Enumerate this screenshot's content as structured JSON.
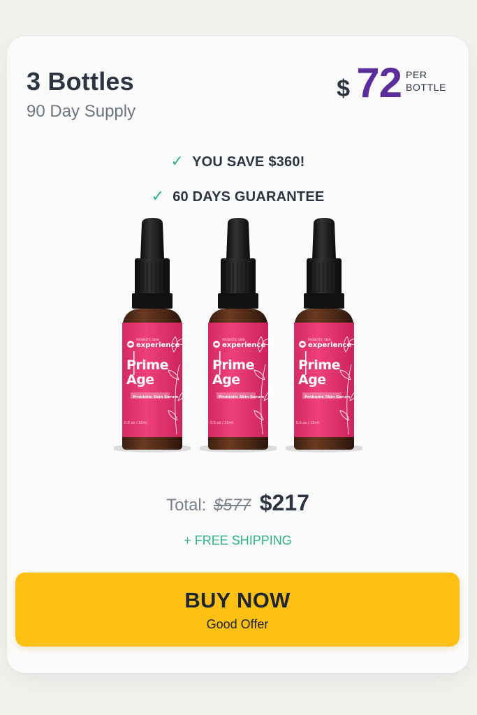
{
  "offer": {
    "title": "3 Bottles",
    "subtitle": "90 Day Supply",
    "currency_symbol": "$",
    "price_per_bottle": "72",
    "per_label_line1": "PER",
    "per_label_line2": "BOTTLE"
  },
  "benefits": [
    {
      "icon": "check-icon",
      "text": "YOU SAVE $360!"
    },
    {
      "icon": "check-icon",
      "text": "60 DAYS GUARANTEE"
    }
  ],
  "product": {
    "brand_small": "PROBIOTIC SKIN",
    "brand": "experience",
    "name_line1": "Prime",
    "name_line2": "Age",
    "tagline": "Probiotic Skin Serum",
    "volume": "0.5 oz / 15ml",
    "bottle_count": 3
  },
  "total": {
    "label": "Total:",
    "old_price": "$577",
    "new_price": "$217"
  },
  "shipping": "+ FREE SHIPPING",
  "cta": {
    "main": "BUY NOW",
    "sub": "Good Offer"
  },
  "colors": {
    "accent_price": "#5a2d9a",
    "check_green": "#2eb287",
    "button_yellow": "#ffc014",
    "label_pink": "#e8356f",
    "text_dark": "#2c3442"
  }
}
